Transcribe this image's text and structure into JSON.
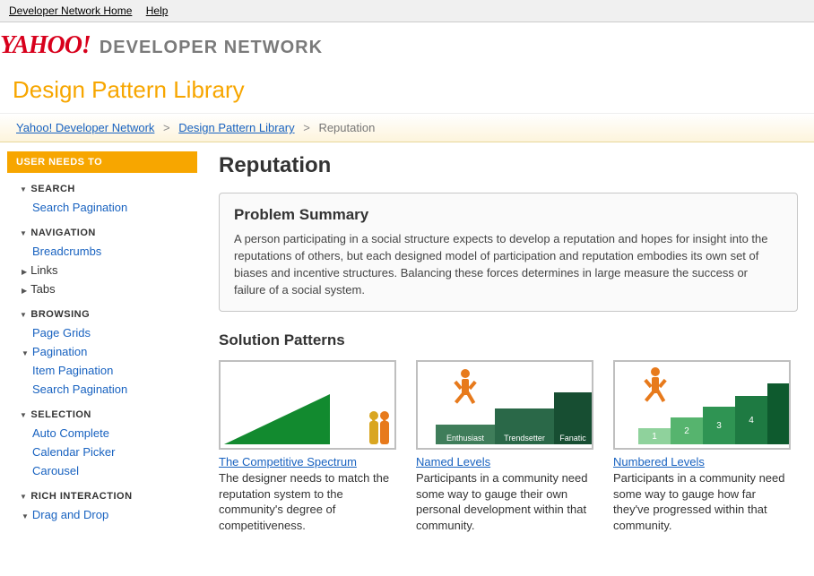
{
  "topbar": {
    "home": "Developer Network Home",
    "help": "Help"
  },
  "header": {
    "logo_left": "YAHOO",
    "logo_bang": "!",
    "logo_right": "DEVELOPER NETWORK",
    "page_title": "Design Pattern Library"
  },
  "breadcrumb": {
    "items": [
      {
        "label": "Yahoo! Developer Network",
        "link": true
      },
      {
        "label": "Design Pattern Library",
        "link": true
      },
      {
        "label": "Reputation",
        "link": false
      }
    ],
    "sep": ">"
  },
  "sidebar": {
    "heading": "USER NEEDS TO",
    "groups": [
      {
        "title": "SEARCH",
        "items": [
          {
            "label": "Search Pagination",
            "type": "link"
          }
        ]
      },
      {
        "title": "NAVIGATION",
        "items": [
          {
            "label": "Breadcrumbs",
            "type": "link"
          },
          {
            "label": "Links",
            "type": "closed"
          },
          {
            "label": "Tabs",
            "type": "closed"
          }
        ]
      },
      {
        "title": "BROWSING",
        "items": [
          {
            "label": "Page Grids",
            "type": "link"
          },
          {
            "label": "Pagination",
            "type": "open",
            "children": [
              {
                "label": "Item Pagination"
              },
              {
                "label": "Search Pagination"
              }
            ]
          }
        ]
      },
      {
        "title": "SELECTION",
        "items": [
          {
            "label": "Auto Complete",
            "type": "link"
          },
          {
            "label": "Calendar Picker",
            "type": "link"
          },
          {
            "label": "Carousel",
            "type": "link"
          }
        ]
      },
      {
        "title": "RICH INTERACTION",
        "items": [
          {
            "label": "Drag and Drop",
            "type": "open-link"
          }
        ]
      }
    ]
  },
  "main": {
    "title": "Reputation",
    "summary_heading": "Problem Summary",
    "summary_body": "A person participating in a social structure expects to develop a reputation and hopes for insight into the reputations of others, but each designed model of participation and reputation embodies its own set of biases and incentive structures. Balancing these forces determines in large measure the success or failure of a social system.",
    "solutions_heading": "Solution Patterns",
    "cards": [
      {
        "title": "The Competitive Spectrum",
        "desc": "The designer needs to match the reputation system to the community's degree of competitiveness."
      },
      {
        "title": "Named Levels",
        "desc": "Participants in a community need some way to gauge their own personal development within that community.",
        "steps": [
          "Enthusiast",
          "Trendsetter",
          "Fanatic"
        ]
      },
      {
        "title": "Numbered Levels",
        "desc": "Participants in a community need some way to gauge how far they've progressed within that community.",
        "steps": [
          "1",
          "2",
          "3",
          "4",
          ""
        ]
      }
    ]
  }
}
